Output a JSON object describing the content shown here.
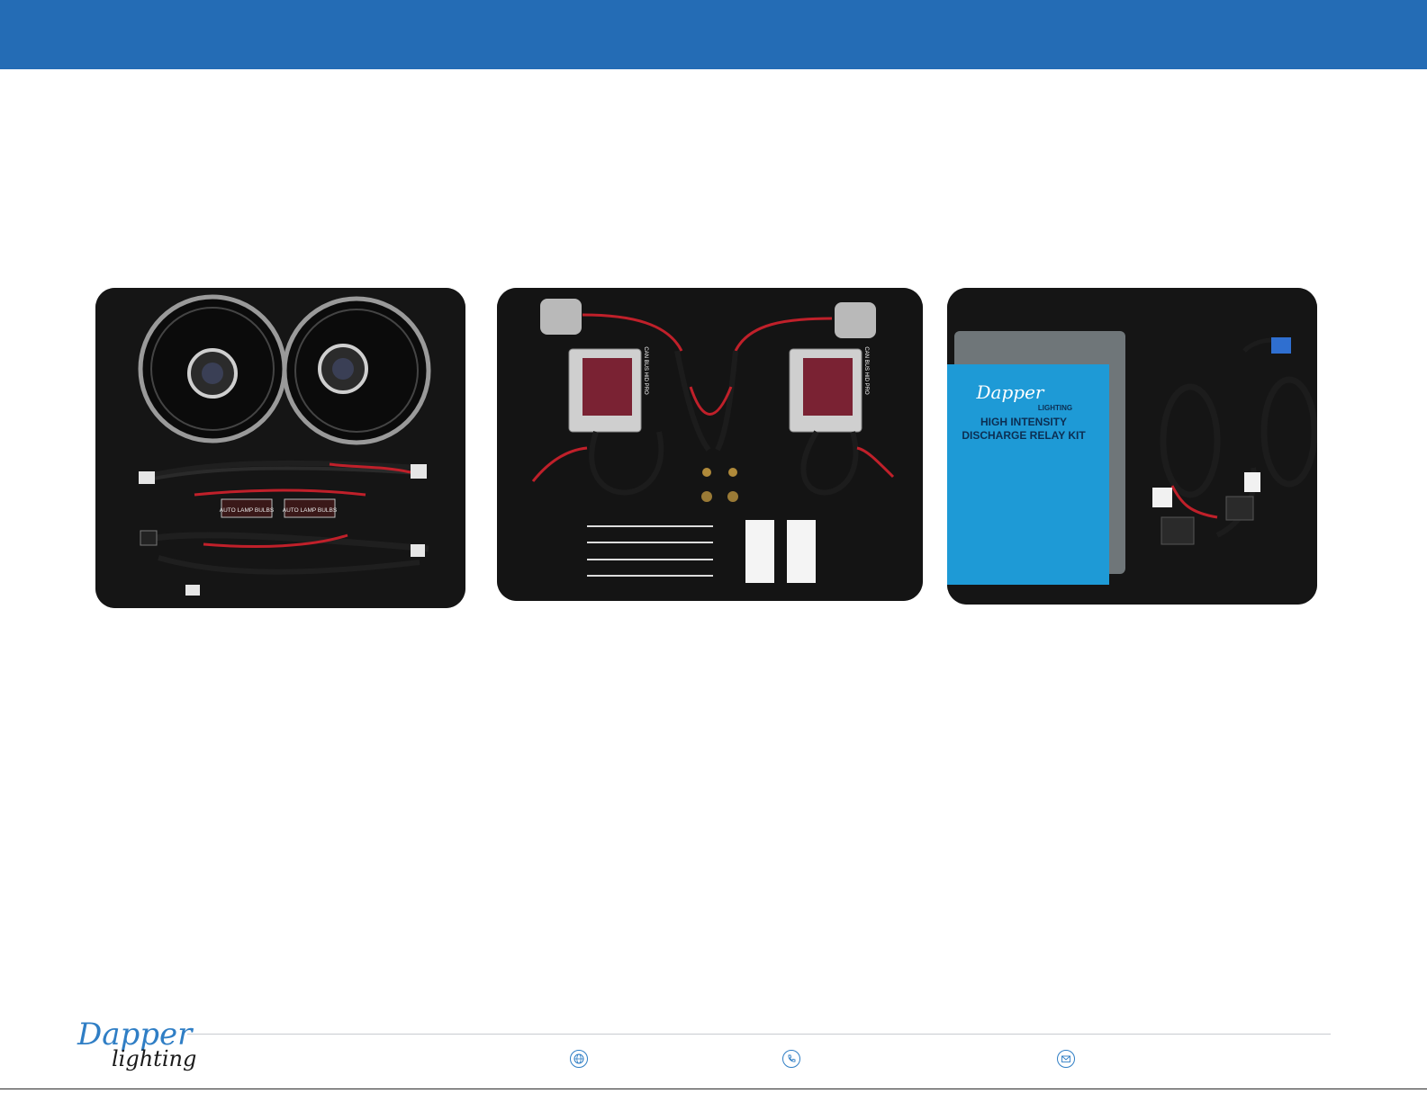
{
  "banner": {
    "color": "#246cb5"
  },
  "photos": {
    "headlights": {
      "bulb_label_1": "AUTO LAMP BULBS",
      "bulb_label_2": "AUTO LAMP BULBS"
    },
    "ballasts": {
      "ballast_label_1": "CAN BUS HID PRO",
      "ballast_label_2": "CAN BUS HID PRO"
    },
    "relay": {
      "brand": "Dapper",
      "brand_sub": "LIGHTING",
      "title_line_1": "HIGH INTENSITY",
      "title_line_2": "DISCHARGE RELAY KIT"
    }
  },
  "footer": {
    "logo_word_1": "Dapper",
    "logo_word_2": "lighting",
    "icons": [
      "globe-icon",
      "phone-icon",
      "mail-icon"
    ],
    "accent": "#2f7ec5"
  }
}
